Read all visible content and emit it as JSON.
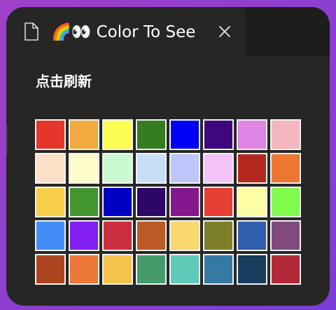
{
  "tab": {
    "title": "🌈👀 Color To See",
    "icon": "file-icon",
    "close_icon": "close-icon"
  },
  "refresh_label": "点击刷新",
  "colors": {
    "window_background": "#262624",
    "tabbar_background": "#1d1d1c",
    "text": "#ffffff",
    "swatch_border": "#f2f2f2"
  },
  "swatches": [
    "#e6352a",
    "#f2a940",
    "#fcfc55",
    "#367d20",
    "#0000f5",
    "#3f077d",
    "#e084e5",
    "#f4b6bf",
    "#fbe0c6",
    "#fdfdc9",
    "#cbf9d1",
    "#c6def8",
    "#bdc5fa",
    "#f3c2f9",
    "#b2271e",
    "#ed7630",
    "#f8ce48",
    "#42952f",
    "#0000c4",
    "#2c0765",
    "#84178e",
    "#e63f34",
    "#fdfda6",
    "#81f94d",
    "#428ef6",
    "#8120f2",
    "#c92f3f",
    "#bb5a25",
    "#f8d86f",
    "#7c7f28",
    "#305dae",
    "#824b80",
    "#ad4520",
    "#ec7736",
    "#f5c34b",
    "#459b69",
    "#60c9b7",
    "#3679a2",
    "#183d5d",
    "#b2293a"
  ]
}
